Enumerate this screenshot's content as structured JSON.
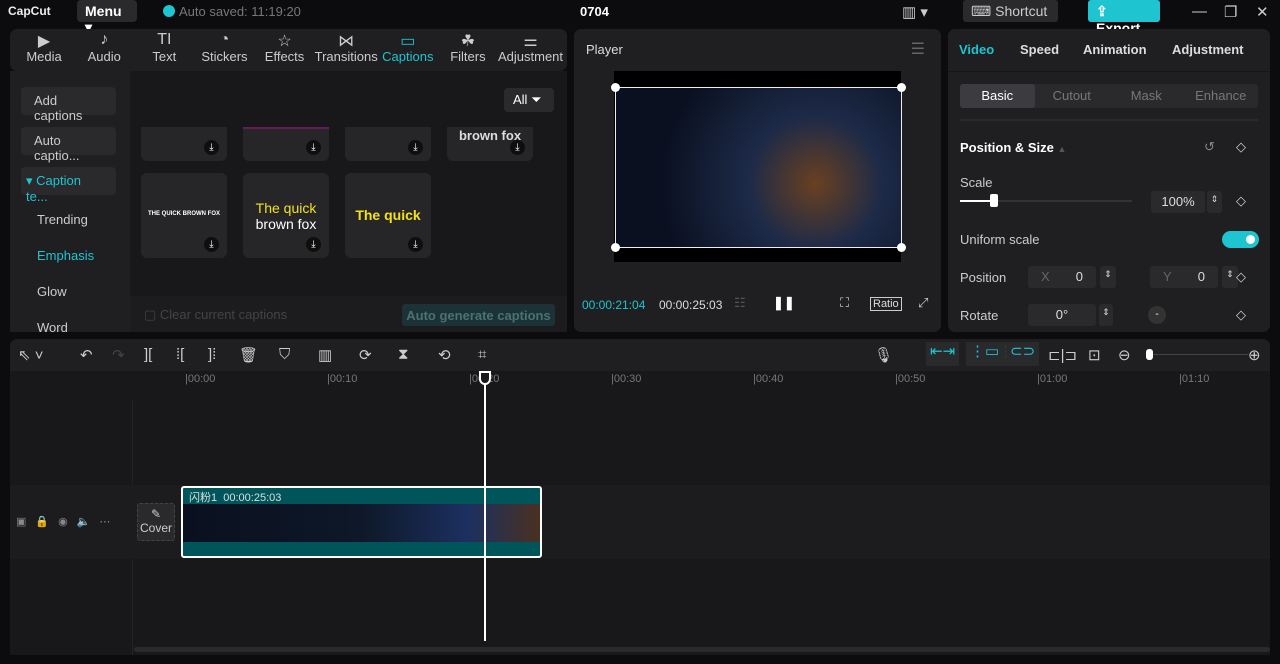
{
  "app": {
    "logo": "CapCut",
    "menu": "Menu",
    "autosave": "Auto saved: 11:19:20",
    "project": "0704",
    "shortcut": "Shortcut",
    "export": "Export"
  },
  "tabs": [
    {
      "icon": "▶",
      "label": "Media"
    },
    {
      "icon": "♪",
      "label": "Audio"
    },
    {
      "icon": "TI",
      "label": "Text"
    },
    {
      "icon": "◔",
      "label": "Stickers"
    },
    {
      "icon": "☆",
      "label": "Effects"
    },
    {
      "icon": "⋈",
      "label": "Transitions"
    },
    {
      "icon": "▭",
      "label": "Captions"
    },
    {
      "icon": "☘",
      "label": "Filters"
    },
    {
      "icon": "⚌",
      "label": "Adjustment"
    }
  ],
  "captions_sidebar": {
    "add": "Add captions",
    "auto": "Auto captio...",
    "templates": "▾ Caption te...",
    "items": [
      "Trending",
      "Emphasis",
      "Glow",
      "Word"
    ]
  },
  "captions_grid": {
    "filter": "All",
    "partial_card_text": "brown fox",
    "cards": [
      {
        "line1": "THE QUICK BROWN FOX"
      },
      {
        "line1": "The quick",
        "line2": "brown fox"
      },
      {
        "line1": "The quick"
      }
    ],
    "clear": "Clear current captions",
    "auto_generate": "Auto generate captions"
  },
  "player": {
    "title": "Player",
    "current_time": "00:00:21:04",
    "total_time": "00:00:25:03",
    "ratio": "Ratio"
  },
  "props": {
    "tabs": [
      "Video",
      "Speed",
      "Animation",
      "Adjustment"
    ],
    "subtabs": [
      "Basic",
      "Cutout",
      "Mask",
      "Enhance"
    ],
    "section": "Position & Size",
    "scale_label": "Scale",
    "scale": "100%",
    "scale_fraction": 0.2,
    "uniform": "Uniform scale",
    "uniform_on": true,
    "position": "Position",
    "x_label": "X",
    "x": "0",
    "y_label": "Y",
    "y": "0",
    "rotate": "Rotate",
    "rotate_val": "0°"
  },
  "timeline": {
    "ticks": [
      "00:00",
      "00:10",
      "00:20",
      "00:30",
      "00:40",
      "00:50",
      "01:00",
      "01:10"
    ],
    "cover": "Cover",
    "clip_name": "闪粉1",
    "clip_duration": "00:00:25:03",
    "playhead_seconds": 21.1
  }
}
